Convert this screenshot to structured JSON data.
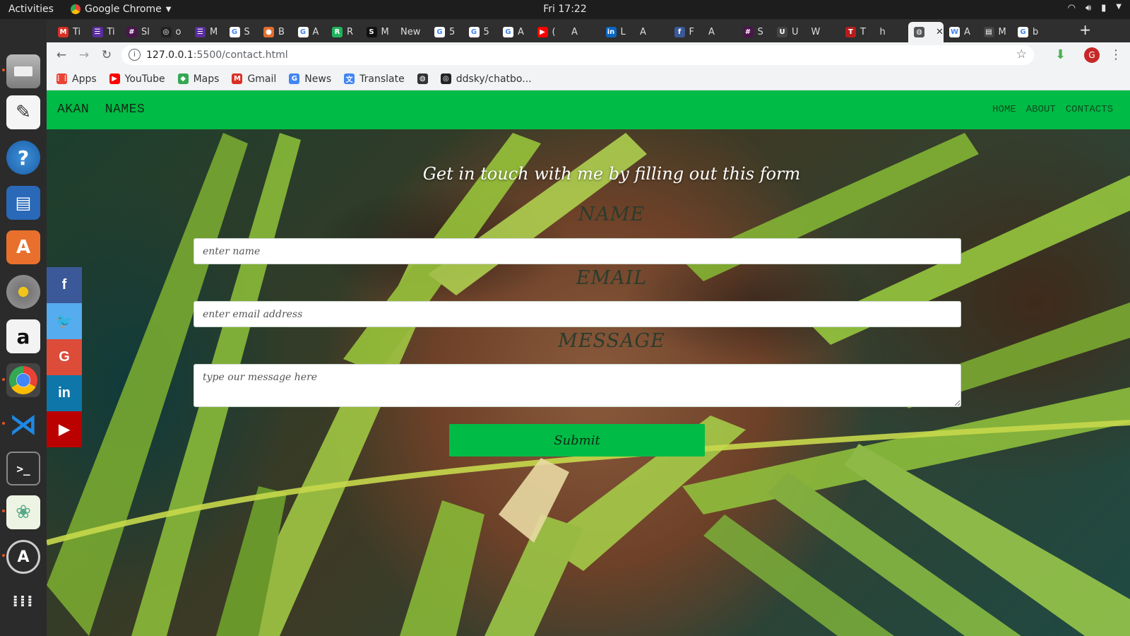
{
  "system": {
    "activities": "Activities",
    "app_name": "Google Chrome",
    "clock": "Fri 17:22"
  },
  "browser": {
    "tabs": [
      {
        "label": "Ti",
        "icon": "gmail-icon",
        "color": "#d93025",
        "glyph": "M"
      },
      {
        "label": "Ti",
        "icon": "checklist-icon",
        "color": "#5b2ca0",
        "glyph": "☰"
      },
      {
        "label": "Sl",
        "icon": "slack-icon",
        "color": "#4a154b",
        "glyph": "#"
      },
      {
        "label": "o",
        "icon": "github-icon",
        "color": "#222222",
        "glyph": "◎"
      },
      {
        "label": "M",
        "icon": "checklist-icon",
        "color": "#5b2ca0",
        "glyph": "☰"
      },
      {
        "label": "S",
        "icon": "google-icon",
        "color": "#ffffff",
        "glyph": "G"
      },
      {
        "label": "B",
        "icon": "bitbucket-icon",
        "color": "#e2702f",
        "glyph": "●"
      },
      {
        "label": "A",
        "icon": "google-icon",
        "color": "#ffffff",
        "glyph": "G"
      },
      {
        "label": "R",
        "icon": "replit-icon",
        "color": "#1fb35b",
        "glyph": "R"
      },
      {
        "label": "M",
        "icon": "stackshare-icon",
        "color": "#111111",
        "glyph": "S"
      },
      {
        "label": "New",
        "icon": "",
        "color": "",
        "glyph": ""
      },
      {
        "label": "5",
        "icon": "google-icon",
        "color": "#ffffff",
        "glyph": "G"
      },
      {
        "label": "5",
        "icon": "google-icon",
        "color": "#ffffff",
        "glyph": "G"
      },
      {
        "label": "A",
        "icon": "google-icon",
        "color": "#ffffff",
        "glyph": "G"
      },
      {
        "label": "(",
        "icon": "youtube-icon",
        "color": "#ff0000",
        "glyph": "▶"
      },
      {
        "label": "A",
        "icon": "",
        "color": "",
        "glyph": ""
      },
      {
        "label": "L",
        "icon": "linkedin-icon",
        "color": "#0a66c2",
        "glyph": "in"
      },
      {
        "label": "A",
        "icon": "",
        "color": "",
        "glyph": ""
      },
      {
        "label": "F",
        "icon": "facebook-icon",
        "color": "#3b5998",
        "glyph": "f"
      },
      {
        "label": "A",
        "icon": "",
        "color": "",
        "glyph": ""
      },
      {
        "label": "S",
        "icon": "slack-icon",
        "color": "#4a154b",
        "glyph": "#"
      },
      {
        "label": "U",
        "icon": "udacity-icon",
        "color": "#444444",
        "glyph": "U"
      },
      {
        "label": "W",
        "icon": "",
        "color": "",
        "glyph": ""
      },
      {
        "label": "T",
        "icon": "trello-icon",
        "color": "#b71c1c",
        "glyph": "T"
      },
      {
        "label": "h",
        "icon": "",
        "color": "",
        "glyph": ""
      },
      {
        "label": "",
        "icon": "globe-icon",
        "color": "#555555",
        "glyph": "◍",
        "active": true
      },
      {
        "label": "A",
        "icon": "wikipedia-icon",
        "color": "#ffffff",
        "glyph": "W"
      },
      {
        "label": "M",
        "icon": "doc-icon",
        "color": "#444444",
        "glyph": "▤"
      },
      {
        "label": "b",
        "icon": "google-icon",
        "color": "#ffffff",
        "glyph": "G"
      }
    ],
    "url_host": "127.0.0.1",
    "url_rest": ":5500/contact.html",
    "profile_initial": "G",
    "bookmarks": [
      {
        "label": "Apps",
        "icon": "apps-grid-icon",
        "color": "#ea4335",
        "glyph": "⋮⋮"
      },
      {
        "label": "YouTube",
        "icon": "youtube-icon",
        "color": "#ff0000",
        "glyph": "▶"
      },
      {
        "label": "Maps",
        "icon": "maps-icon",
        "color": "#34a853",
        "glyph": "◆"
      },
      {
        "label": "Gmail",
        "icon": "gmail-icon",
        "color": "#d93025",
        "glyph": "M"
      },
      {
        "label": "News",
        "icon": "news-icon",
        "color": "#4285f4",
        "glyph": "G"
      },
      {
        "label": "Translate",
        "icon": "translate-icon",
        "color": "#4285f4",
        "glyph": "文"
      },
      {
        "label": "",
        "icon": "globe-icon",
        "color": "#333333",
        "glyph": "◍"
      },
      {
        "label": "ddsky/chatbo...",
        "icon": "github-icon",
        "color": "#222222",
        "glyph": "◎"
      }
    ]
  },
  "page": {
    "brand": "AKAN  NAMES",
    "nav": [
      "HOME",
      "ABOUT",
      "CONTACTS"
    ],
    "form_title": "Get in touch with me by filling out this form",
    "name_label": "NAME",
    "name_placeholder": "enter name",
    "email_label": "EMAIL",
    "email_placeholder": "enter email address",
    "message_label": "MESSAGE",
    "message_placeholder": "type our message here",
    "submit_label": "Submit",
    "accent_color": "#00bb45",
    "social": [
      {
        "name": "facebook",
        "glyph": "f",
        "color": "#3b5998"
      },
      {
        "name": "twitter",
        "glyph": "🐦",
        "color": "#55acee"
      },
      {
        "name": "google",
        "glyph": "G",
        "color": "#dd4b39"
      },
      {
        "name": "linkedin",
        "glyph": "in",
        "color": "#0e76a8"
      },
      {
        "name": "youtube",
        "glyph": "▶",
        "color": "#bb0000"
      }
    ]
  }
}
